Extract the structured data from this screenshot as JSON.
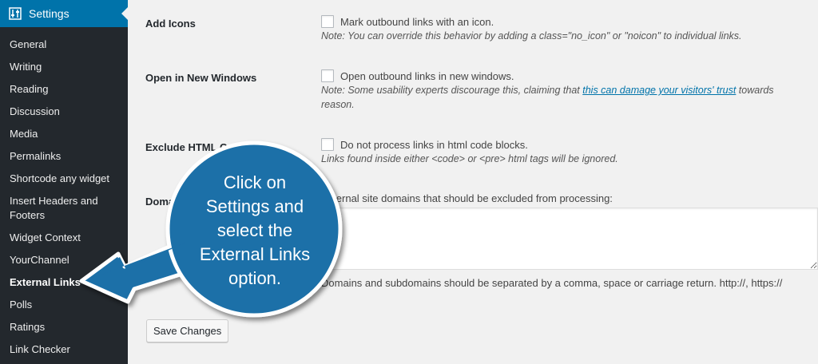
{
  "sidebar": {
    "header_label": "Settings",
    "items": [
      {
        "label": "General"
      },
      {
        "label": "Writing"
      },
      {
        "label": "Reading"
      },
      {
        "label": "Discussion"
      },
      {
        "label": "Media"
      },
      {
        "label": "Permalinks"
      },
      {
        "label": "Shortcode any widget"
      },
      {
        "label": "Insert Headers and Footers"
      },
      {
        "label": "Widget Context"
      },
      {
        "label": "YourChannel"
      },
      {
        "label": "External Links",
        "current": true
      },
      {
        "label": "Polls"
      },
      {
        "label": "Ratings"
      },
      {
        "label": "Link Checker"
      }
    ]
  },
  "settings": {
    "add_icons": {
      "label": "Add Icons",
      "checkbox_label": "Mark outbound links with an icon.",
      "checked": false,
      "note": "Note: You can override this behavior by adding a class=\"no_icon\" or \"noicon\" to individual links."
    },
    "new_windows": {
      "label": "Open in New Windows",
      "checkbox_label": "Open outbound links in new windows.",
      "checked": false,
      "note_prefix": "Note: Some usability experts discourage this, claiming that ",
      "note_link": "this can damage your visitors' trust",
      "note_suffix": " towards",
      "note_line2": "reason."
    },
    "exclude_code": {
      "label": "Exclude HTML Code Blocks",
      "checkbox_label": "Do not process links in html code blocks.",
      "checked": false,
      "note": "Links found inside either <code> or <pre> html tags will be ignored."
    },
    "domains": {
      "label": "Domains",
      "description": "External site domains that should be excluded from processing:",
      "value": "",
      "hint": "Domains and subdomains should be separated by a comma, space or carriage return.  http://, https://"
    }
  },
  "save_button_label": "Save Changes",
  "callout": {
    "line1": "Click on",
    "line2": "Settings and",
    "line3": "select the",
    "line4": "External Links",
    "line5": "option.",
    "color": "#1b6fa8"
  },
  "colors": {
    "sidebar_bg": "#23282d",
    "accent": "#0073aa",
    "page_bg": "#f1f1f1"
  }
}
